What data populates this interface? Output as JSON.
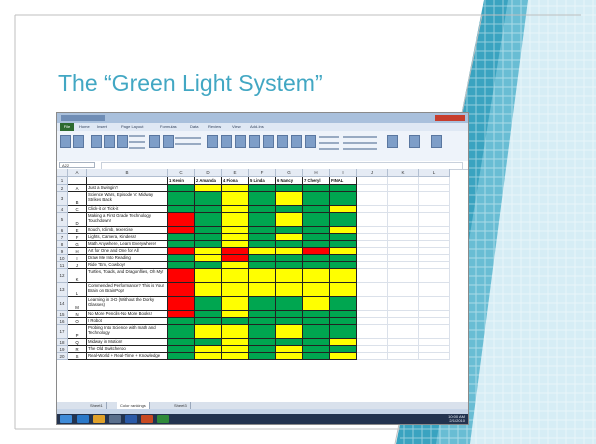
{
  "slide": {
    "title": "The “Green Light System”"
  },
  "colors": {
    "title_color": "#42a7c3",
    "accent_teal": "#3aa3c0",
    "green": "#00a650",
    "yellow": "#ffff00",
    "red": "#ff0000"
  },
  "excel": {
    "file_tab": "File",
    "menu_tabs": [
      "Home",
      "Insert",
      "Page Layout",
      "Formulas",
      "Data",
      "Review",
      "View",
      "Add-Ins"
    ],
    "name_box": "A22",
    "sheet_tabs": [
      "Sheet1",
      "Color rankings",
      "Sheet3"
    ],
    "active_sheet_index": 1,
    "columns": [
      "A",
      "B",
      "C",
      "D",
      "E",
      "F",
      "G",
      "H",
      "I",
      "J",
      "K",
      "L"
    ],
    "rating_headers": [
      "1 Kevin",
      "2 Amanda",
      "4 Fiona",
      "5 Linda",
      "6 Nancy",
      "7 Cheryl",
      "FINAL"
    ],
    "rows": [
      {
        "num": "2",
        "letter": "A",
        "title": "Just a Swingin'!",
        "ratings": [
          "G",
          "Y",
          "Y",
          "G",
          "G",
          "G",
          "G"
        ]
      },
      {
        "num": "3",
        "letter": "B",
        "title": "Science Wars, Episode V: Midway Strikes Back",
        "ratings": [
          "G",
          "G",
          "Y",
          "G",
          "Y",
          "G",
          "G"
        ]
      },
      {
        "num": "4",
        "letter": "C",
        "title": "Click-it or Tick-it",
        "ratings": [
          "G",
          "G",
          "Y",
          "G",
          "G",
          "G",
          "Y"
        ]
      },
      {
        "num": "5",
        "letter": "D",
        "title": "Making a First Grade Technology Touchdown!",
        "ratings": [
          "R",
          "G",
          "Y",
          "G",
          "Y",
          "G",
          "G"
        ]
      },
      {
        "num": "6",
        "letter": "E",
        "title": "Itouch, Iclimb, Iexercise",
        "ratings": [
          "R",
          "G",
          "Y",
          "G",
          "G",
          "G",
          "Y"
        ]
      },
      {
        "num": "7",
        "letter": "F",
        "title": "Lights, Camera, Kindess!",
        "ratings": [
          "G",
          "G",
          "Y",
          "G",
          "Y",
          "G",
          "G"
        ]
      },
      {
        "num": "8",
        "letter": "G",
        "title": "Math Anywhere, Learn Everywhere!",
        "ratings": [
          "G",
          "G",
          "Y",
          "G",
          "G",
          "G",
          "G"
        ]
      },
      {
        "num": "9",
        "letter": "H",
        "title": "Art for One and One for All",
        "ratings": [
          "R",
          "Y",
          "R",
          "Y",
          "Y",
          "R",
          "Y"
        ]
      },
      {
        "num": "10",
        "letter": "I",
        "title": "Draw Me Into Reading",
        "ratings": [
          "G",
          "Y",
          "R",
          "G",
          "G",
          "G",
          "G"
        ]
      },
      {
        "num": "11",
        "letter": "J",
        "title": "Ride \"Em, Cowboy!",
        "ratings": [
          "G",
          "G",
          "Y",
          "G",
          "G",
          "G",
          "G"
        ]
      },
      {
        "num": "12",
        "letter": "K",
        "title": "Turtles, Toads, and Dragonflies, Oh My!",
        "ratings": [
          "R",
          "Y",
          "Y",
          "Y",
          "Y",
          "Y",
          "Y"
        ]
      },
      {
        "num": "13",
        "letter": "L",
        "title": "Commended Performance? This is Your Brain on BrainPop!",
        "ratings": [
          "R",
          "Y",
          "Y",
          "Y",
          "Y",
          "Y",
          "Y"
        ]
      },
      {
        "num": "14",
        "letter": "M",
        "title": "Learning in 3-D (Without the Dorky Glasses)",
        "ratings": [
          "R",
          "G",
          "Y",
          "G",
          "G",
          "Y",
          "G"
        ]
      },
      {
        "num": "15",
        "letter": "N",
        "title": "No More Pencils-No More Books!",
        "ratings": [
          "R",
          "G",
          "Y",
          "G",
          "G",
          "G",
          "G"
        ]
      },
      {
        "num": "16",
        "letter": "O",
        "title": "I Robot",
        "ratings": [
          "G",
          "G",
          "G",
          "G",
          "G",
          "G",
          "G"
        ]
      },
      {
        "num": "17",
        "letter": "P",
        "title": "Probing Into Science with math and Technology",
        "ratings": [
          "G",
          "Y",
          "Y",
          "G",
          "Y",
          "G",
          "G"
        ]
      },
      {
        "num": "18",
        "letter": "Q",
        "title": "Midway in Motion!",
        "ratings": [
          "G",
          "G",
          "Y",
          "G",
          "G",
          "G",
          "Y"
        ]
      },
      {
        "num": "19",
        "letter": "R",
        "title": "The Old Switcheroo",
        "ratings": [
          "G",
          "Y",
          "Y",
          "G",
          "Y",
          "G",
          "G"
        ]
      },
      {
        "num": "20",
        "letter": "S",
        "title": "Real-World + Real-Time + Knowledge",
        "ratings": [
          "G",
          "Y",
          "Y",
          "G",
          "Y",
          "G",
          "Y"
        ]
      }
    ],
    "tray": "10:00 AM\n2/1/2010"
  }
}
